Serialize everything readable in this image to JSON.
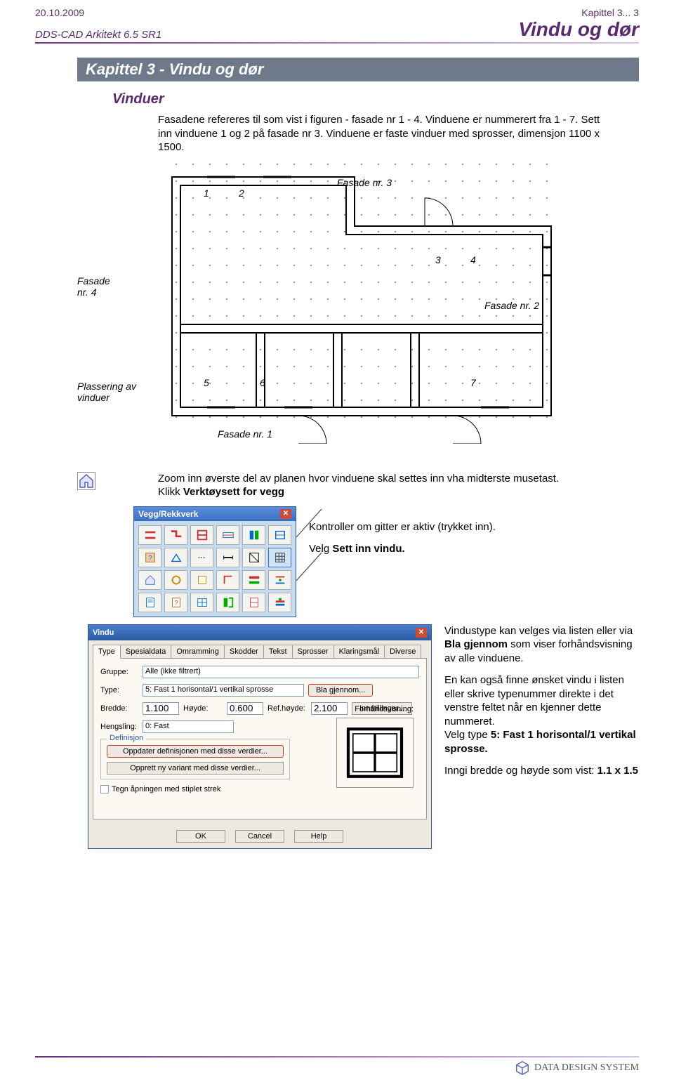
{
  "header": {
    "date": "20.10.2009",
    "chapter_ref": "Kapittel 3... 3",
    "product": "DDS-CAD Arkitekt 6.5  SR1",
    "title": "Vindu og dør"
  },
  "chapter_bar": "Kapittel 3  - Vindu og dør",
  "section_heading": "Vinduer",
  "intro_text": "Fasadene refereres til som vist i figuren - fasade nr 1 - 4. Vinduene er nummerert fra 1 - 7. Sett inn vinduene 1 og 2 på fasade nr 3. Vinduene er faste vinduer med sprosser, dimensjon 1100 x 1500.",
  "plan": {
    "label_4": "Fasade\nnr. 4",
    "label_3": "Fasade nr. 3",
    "label_2": "Fasade nr. 2",
    "label_1": "Fasade nr. 1",
    "label_placement": "Plassering av\nvinduer",
    "n1": "1",
    "n2": "2",
    "n3": "3",
    "n4": "4",
    "n5": "5",
    "n6": "6",
    "n7": "7"
  },
  "body2_a": "Zoom inn øverste del av planen hvor vinduene skal settes inn vha midterste musetast.",
  "body2_b_prefix": "Klikk ",
  "body2_b_bold": "Verktøysett for vegg",
  "toolbox_title": "Vegg/Rekkverk",
  "note_gitter": "Kontroller om gitter er aktiv (trykket inn).",
  "note_sett_prefix": "Velg ",
  "note_sett_bold": "Sett inn vindu.",
  "vindu": {
    "title": "Vindu",
    "tabs": [
      "Type",
      "Spesialdata",
      "Omramming",
      "Skodder",
      "Tekst",
      "Sprosser",
      "Klaringsmål",
      "Diverse"
    ],
    "gruppe_label": "Gruppe:",
    "gruppe_value": "Alle (ikke filtrert)",
    "type_label": "Type:",
    "type_value": "5: Fast 1 horisontal/1 vertikal sprosse",
    "bla_btn": "Bla gjennom...",
    "bredde_label": "Bredde:",
    "bredde_value": "1.100",
    "hoyde_label": "Høyde:",
    "hoyde_value": "0.600",
    "refh_label": "Ref.høyde:",
    "refh_value": "2.100",
    "innst_btn": "Innstillinger...",
    "hengsling_label": "Hengsling:",
    "hengsling_value": "0: Fast",
    "preview_label": "Forhåndsvisning:",
    "def_legend": "Definisjon",
    "def_btn1": "Oppdater definisjonen med disse verdier...",
    "def_btn2": "Opprett ny variant med disse verdier...",
    "chk_label": "Tegn åpningen med stiplet strek",
    "ok": "OK",
    "cancel": "Cancel",
    "help": "Help"
  },
  "rightcol2": {
    "p1_a": "Vindustype kan velges via listen eller via ",
    "p1_b": "Bla gjennom",
    "p1_c": " som viser forhåndsvisning av alle vinduene.",
    "p2_a": "En kan også finne ønsket vindu i listen eller skrive typenummer direkte i det venstre feltet når en kjenner dette nummeret.",
    "p2_b": "Velg type ",
    "p2_c": "5: Fast 1 horisontal/1 vertikal sprosse.",
    "p3_a": "Inngi bredde og høyde som vist:  ",
    "p3_b": "1.1 x 1.5"
  },
  "footer_brand": "DATA DESIGN SYSTEM"
}
